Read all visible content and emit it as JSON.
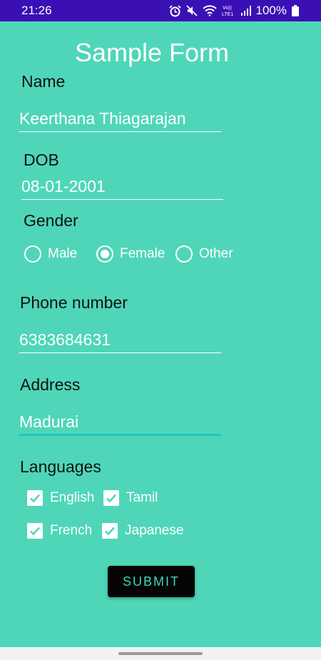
{
  "status_bar": {
    "time": "21:26",
    "battery_text": "100%",
    "icons": [
      "alarm-icon",
      "mute-icon",
      "wifi-icon",
      "volte-icon",
      "signal-icon",
      "battery-icon"
    ]
  },
  "form": {
    "title": "Sample Form",
    "name": {
      "label": "Name",
      "value": "Keerthana Thiagarajan"
    },
    "dob": {
      "label": "DOB",
      "value": "08-01-2001"
    },
    "gender": {
      "label": "Gender",
      "options": [
        "Male",
        "Female",
        "Other"
      ],
      "selected": "Female"
    },
    "phone": {
      "label": "Phone number",
      "value": "6383684631"
    },
    "address": {
      "label": "Address",
      "value": "Madurai"
    },
    "languages": {
      "label": "Languages",
      "options": [
        {
          "label": "English",
          "checked": true
        },
        {
          "label": "Tamil",
          "checked": true
        },
        {
          "label": "French",
          "checked": true
        },
        {
          "label": "Japanese",
          "checked": true
        }
      ]
    },
    "submit_label": "SUBMIT"
  },
  "colors": {
    "background": "#4fd6b9",
    "status_bar": "#3a0fb4",
    "focus_accent": "#1ec6c2",
    "button": "#050505",
    "button_text": "#3cd6b6"
  }
}
